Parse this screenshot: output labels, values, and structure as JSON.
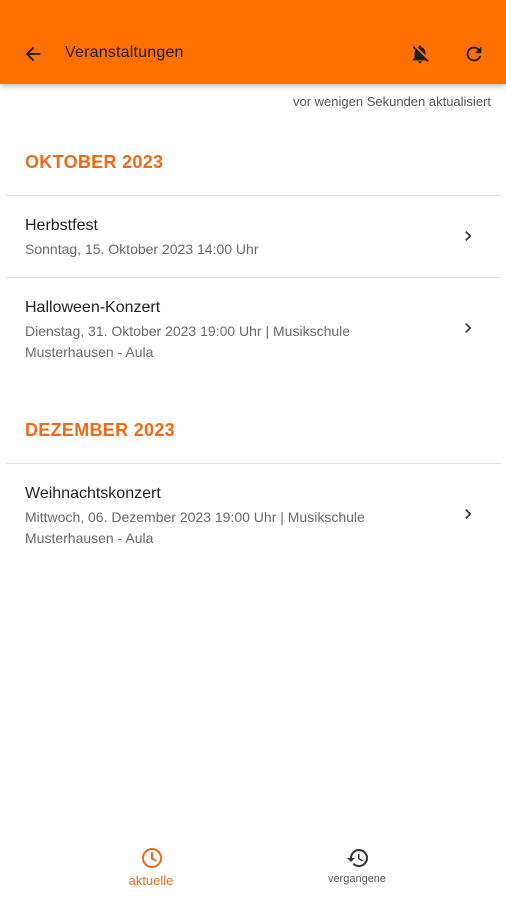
{
  "appbar": {
    "title": "Veranstaltungen",
    "back_icon": "arrow-left-icon",
    "notifications_icon": "bell-off-icon",
    "refresh_icon": "refresh-icon",
    "color": "#ff7000"
  },
  "status": {
    "updated_text": "vor wenigen Sekunden aktualisiert"
  },
  "sections": [
    {
      "title": "OKTOBER 2023",
      "events": [
        {
          "title": "Herbstfest",
          "subtitle": "Sonntag, 15. Oktober 2023 14:00 Uhr"
        },
        {
          "title": "Halloween-Konzert",
          "subtitle": "Dienstag, 31. Oktober 2023 19:00 Uhr | Musikschule Musterhausen - Aula"
        }
      ]
    },
    {
      "title": "DEZEMBER 2023",
      "events": [
        {
          "title": "Weihnachtskonzert",
          "subtitle": "Mittwoch, 06. Dezember 2023 19:00 Uhr | Musikschule Musterhausen - Aula"
        }
      ]
    }
  ],
  "bottom_nav": {
    "items": [
      {
        "label": "aktuelle",
        "icon": "clock-icon",
        "active": true
      },
      {
        "label": "vergangene",
        "icon": "history-icon",
        "active": false
      }
    ]
  },
  "colors": {
    "accent": "#f06a15",
    "appbar": "#ff7000"
  }
}
